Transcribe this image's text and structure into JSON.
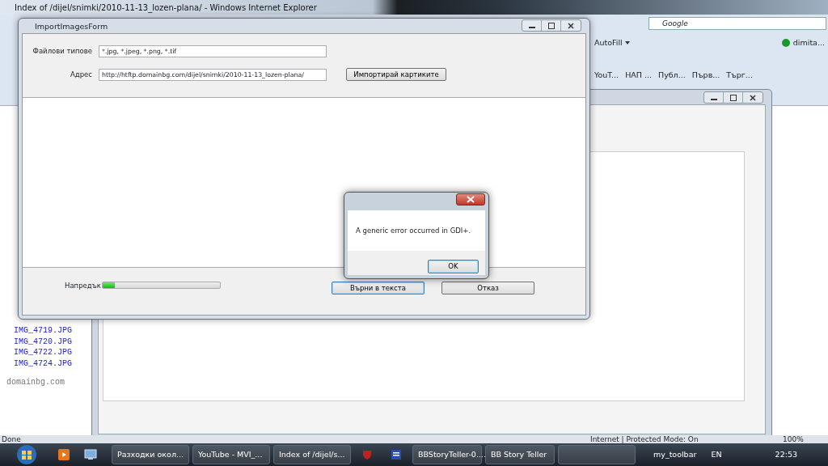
{
  "browser": {
    "title": "Index of /dijel/snimki/2010-11-13_lozen-plana/ - Windows Internet Explorer",
    "search": {
      "placeholder": "Google"
    },
    "toolbar": [
      "AutoFill",
      "dimita..."
    ],
    "favorites": [
      "YouT...",
      "НАП ...",
      "Публ...",
      "Първ...",
      "Търг..."
    ],
    "page": {
      "files": [
        "IMG_4719.JPG",
        "IMG_4720.JPG",
        "IMG_4722.JPG",
        "IMG_4724.JPG"
      ],
      "footer": "domainbg.com"
    },
    "status_bar": {
      "left": "Done",
      "zone": "Internet | Protected Mode: On",
      "zoom": "100%"
    }
  },
  "form": {
    "title": "ImportImagesForm",
    "fields": [
      {
        "label": "Файлови типове",
        "value": "*.jpg, *.jpeg, *.png, *.tif"
      },
      {
        "label": "Адрес",
        "value": "http://htftp.domainbg.com/dijel/snimki/2010-11-13_lozen-plana/"
      }
    ],
    "import_button": "Импортирай картиките",
    "progress": {
      "label": "Напредък",
      "level": 0.1
    },
    "buttons": [
      {
        "label": "Върни в текста",
        "selected": true
      },
      {
        "label": "Отказ",
        "selected": false
      }
    ]
  },
  "dialog": {
    "message": "A generic error occurred in GDI+.",
    "button": "OK"
  },
  "taskbar": {
    "items": [
      {
        "label": "Разходки окол...",
        "selected": false
      },
      {
        "label": "YouTube - MVI_...",
        "selected": false
      },
      {
        "label": "Index of /dijel/s...",
        "selected": false
      },
      {
        "label": "BBStoryTeller-0....",
        "selected": false
      },
      {
        "label": "BB Story Teller",
        "selected": false
      }
    ],
    "toolbar_name": "my_toolbar",
    "language": "EN",
    "time": "22:53"
  }
}
